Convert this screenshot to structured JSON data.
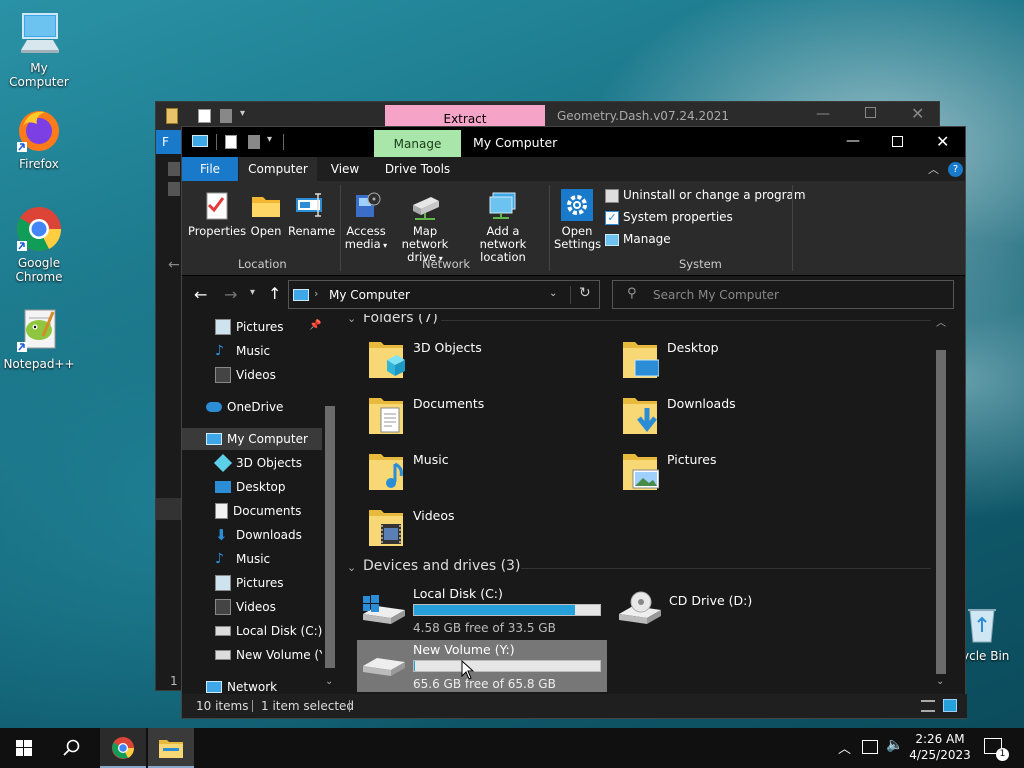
{
  "desktop": {
    "icons": [
      {
        "label": "My Computer"
      },
      {
        "label": "Firefox"
      },
      {
        "label": "Google Chrome"
      },
      {
        "label": "Notepad++"
      },
      {
        "label": "ycle Bin"
      }
    ]
  },
  "back_window": {
    "title": "Geometry.Dash.v07.24.2021",
    "context_tab": "Extract",
    "side_tab": "F"
  },
  "window": {
    "title": "My Computer",
    "context_tab": "Manage",
    "tabs": [
      "File",
      "Computer",
      "View",
      "Drive Tools"
    ],
    "ribbon": {
      "location_group": "Location",
      "network_group": "Network",
      "system_group": "System",
      "properties": "Properties",
      "open": "Open",
      "rename": "Rename",
      "access_media_1": "Access",
      "access_media_2": "media",
      "map_drive_1": "Map network",
      "map_drive_2": "drive",
      "add_location_1": "Add a network",
      "add_location_2": "location",
      "open_settings_1": "Open",
      "open_settings_2": "Settings",
      "uninstall": "Uninstall or change a program",
      "system_properties": "System properties",
      "manage": "Manage"
    },
    "address": {
      "path": "My Computer",
      "search_placeholder": "Search My Computer"
    },
    "nav": {
      "items": [
        "Pictures",
        "Music",
        "Videos",
        "OneDrive",
        "My Computer",
        "3D Objects",
        "Desktop",
        "Documents",
        "Downloads",
        "Music",
        "Pictures",
        "Videos",
        "Local Disk (C:)",
        "New Volume (Y:)",
        "Network"
      ]
    },
    "content": {
      "folders_header": "Folders (7)",
      "folders": [
        "3D Objects",
        "Desktop",
        "Documents",
        "Downloads",
        "Music",
        "Pictures",
        "Videos"
      ],
      "devices_header": "Devices and drives (3)",
      "drives": [
        {
          "name": "Local Disk (C:)",
          "free": "4.58 GB free of 33.5 GB",
          "used_fraction": 0.863
        },
        {
          "name": "CD Drive (D:)"
        },
        {
          "name": "New Volume (Y:)",
          "free": "65.6 GB free of 65.8 GB",
          "used_fraction": 0.003
        }
      ]
    },
    "status": {
      "items": "10 items",
      "selected": "1 item selected"
    }
  },
  "taskbar": {
    "time": "2:26 AM",
    "date": "4/25/2023",
    "notification_count": "1"
  },
  "colors": {
    "accent": "#26a0da",
    "manage_tab": "#a9e6a9",
    "extract_tab": "#f5a3c7",
    "file_tab": "#1979ca"
  }
}
